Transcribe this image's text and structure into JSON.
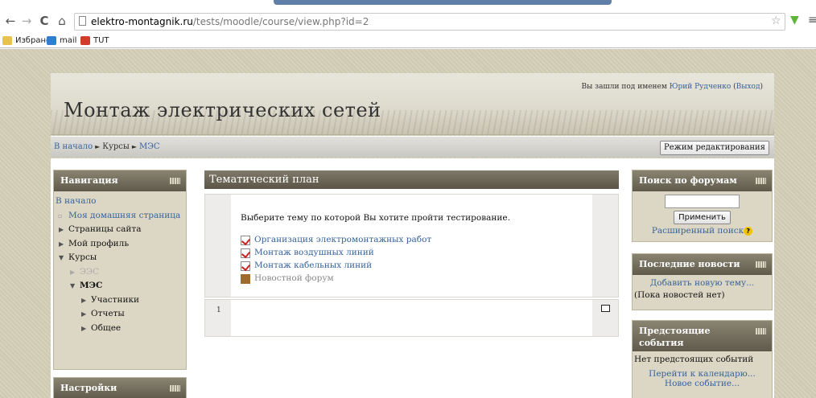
{
  "browser": {
    "back_icon": "←",
    "forward_icon": "→",
    "reload_icon": "C",
    "home_icon": "⌂",
    "url_host": "elektro-montagnik.ru",
    "url_path": "/tests/moodle/course/view.php?id=2",
    "star_icon": "☆",
    "menu_icon": "≡",
    "bookmarks": [
      {
        "label": "Избраное",
        "icon_color": "#e8c24a"
      },
      {
        "label": "mail",
        "icon_color": "#2f7fd1"
      },
      {
        "label": "TUT",
        "icon_color": "#d23a2a"
      }
    ]
  },
  "header": {
    "site_title": "Монтаж электрических сетей",
    "login_prefix": "Вы зашли под именем ",
    "user_name": "Юрий Рудченко",
    "logout_label": "Выход"
  },
  "navbar": {
    "crumbs": [
      "В начало",
      "Курсы",
      "МЭС"
    ],
    "separator": "►",
    "edit_mode_label": "Режим редактирования"
  },
  "navigation": {
    "title": "Навигация",
    "items": [
      {
        "label": "В начало"
      },
      {
        "label": "Моя домашняя страница"
      },
      {
        "label": "Страницы сайта"
      },
      {
        "label": "Мой профиль"
      },
      {
        "label": "Курсы"
      },
      {
        "label": "ЭЭС"
      },
      {
        "label": "МЭС"
      },
      {
        "label": "Участники"
      },
      {
        "label": "Отчеты"
      },
      {
        "label": "Общее"
      }
    ]
  },
  "settings": {
    "title": "Настройки"
  },
  "main": {
    "title": "Тематический план",
    "intro": "Выберите тему по которой Вы хотите пройти тестирование.",
    "activities": [
      {
        "label": "Организация электромонтажных работ",
        "icon": "quiz-icon"
      },
      {
        "label": "Монтаж воздушных линий",
        "icon": "quiz-icon"
      },
      {
        "label": "Монтаж кабельных линий",
        "icon": "quiz-icon"
      },
      {
        "label": "Новостной форум",
        "icon": "forum-icon"
      }
    ],
    "section1_number": "1"
  },
  "forum_search": {
    "title": "Поиск по форумам",
    "apply_label": "Применить",
    "advanced_label": "Расширенный поиск",
    "help_glyph": "?"
  },
  "news": {
    "title": "Последние новости",
    "add_label": "Добавить новую тему...",
    "empty_label": "(Пока новостей нет)"
  },
  "events": {
    "title": "Предстоящие события",
    "empty_label": "Нет предстоящих событий",
    "calendar_label": "Перейти к календарю...",
    "new_event_label": "Новое событие..."
  },
  "colors": {
    "link": "#36629a",
    "block_bg": "#dcd7c5",
    "block_head": "#6e6858",
    "page_bg": "#cfcab2"
  }
}
